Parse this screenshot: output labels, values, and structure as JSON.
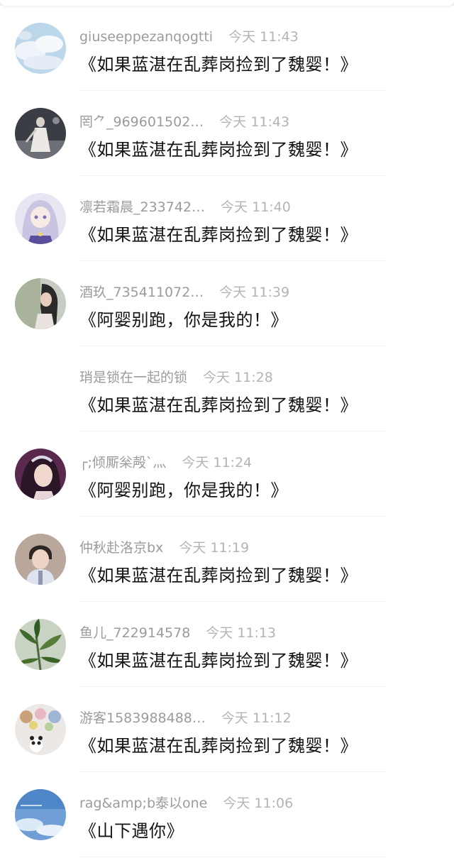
{
  "comments": [
    {
      "user": "giuseeppezanqogtti",
      "time": "今天 11:43",
      "text": "《如果蓝湛在乱葬岗捡到了魏婴！》",
      "avatar": "sky-icon"
    },
    {
      "user": "罔⺈_969601502…",
      "time": "今天 11:43",
      "text": "《如果蓝湛在乱葬岗捡到了魏婴！》",
      "avatar": "dark-figure-icon"
    },
    {
      "user": "凛若霜晨_233742…",
      "time": "今天 11:40",
      "text": "《如果蓝湛在乱葬岗捡到了魏婴！》",
      "avatar": "anime-girl-icon"
    },
    {
      "user": "酒玖_735411072…",
      "time": "今天 11:39",
      "text": "《阿婴别跑，你是我的！》",
      "avatar": "woman-portrait-icon"
    },
    {
      "user": "琑是锁在一起的锁",
      "time": "今天 11:28",
      "text": "《如果蓝湛在乱葬岗捡到了魏婴！》",
      "avatar": ""
    },
    {
      "user": "┌;倾厮枀殸`灬",
      "time": "今天 11:24",
      "text": "《阿婴别跑，你是我的！》",
      "avatar": "woman-headpiece-icon"
    },
    {
      "user": "仲秋赴洛京bx",
      "time": "今天 11:19",
      "text": "《如果蓝湛在乱葬岗捡到了魏婴！》",
      "avatar": "man-portrait-icon"
    },
    {
      "user": "鱼儿_722914578",
      "time": "今天 11:13",
      "text": "《如果蓝湛在乱葬岗捡到了魏婴！》",
      "avatar": "plant-icon"
    },
    {
      "user": "游客1583988488…",
      "time": "今天 11:12",
      "text": "《如果蓝湛在乱葬岗捡到了魏婴！》",
      "avatar": "plush-toys-icon"
    },
    {
      "user": "rag&amp;b泰以one",
      "time": "今天 11:06",
      "text": "《山下遇你》",
      "avatar": "blue-sky-icon"
    }
  ],
  "colors": {
    "name": "#9b9b9b",
    "time": "#b4b4b4",
    "text": "#111111",
    "divider": "#f2f2f2"
  }
}
